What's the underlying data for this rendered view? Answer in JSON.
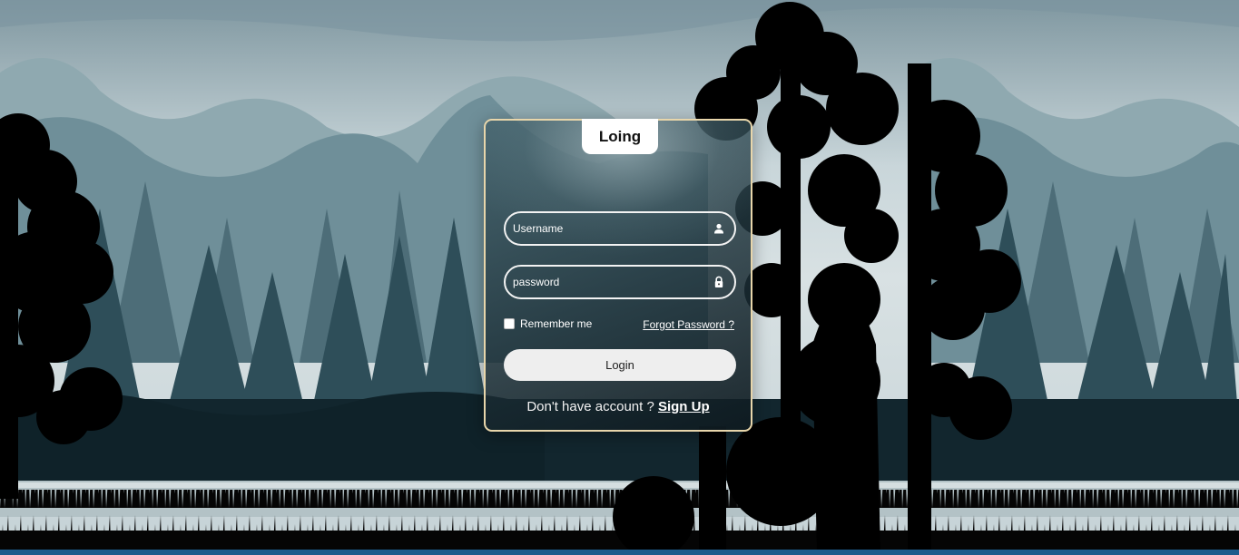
{
  "login_card": {
    "title": "Loing",
    "username_placeholder": "Username",
    "password_placeholder": "password",
    "remember_label": "Remember me",
    "forgot_label": "Forgot Password ?",
    "login_button": "Login",
    "signup_prompt": "Don't have account ? ",
    "signup_link": "Sign Up"
  },
  "icons": {
    "username": "user-icon",
    "password": "lock-icon"
  },
  "colors": {
    "card_border": "#e8d6ab",
    "button_bg": "#eeeeee",
    "text": "#ffffff"
  }
}
